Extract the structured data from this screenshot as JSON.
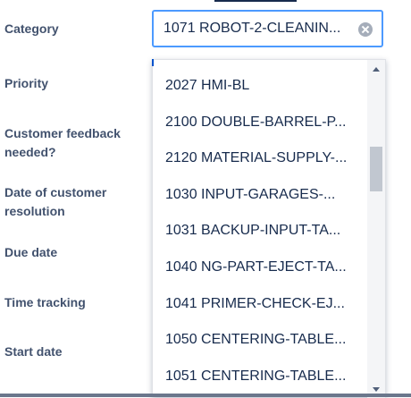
{
  "fields": {
    "category_label": "Category",
    "priority_label": "Priority",
    "customer_feedback_label": "Customer feedback\nneeded?",
    "date_of_customer_resolution_label": "Date of customer\nresolution",
    "due_date_label": "Due date",
    "time_tracking_label": "Time tracking",
    "start_date_label": "Start date"
  },
  "category_select": {
    "value": "1071 ROBOT-2-CLEANIN...",
    "clear_icon": "clear-icon"
  },
  "dropdown": {
    "options": [
      "2027 HMI-BL",
      "2100 DOUBLE-BARREL-P...",
      "2120 MATERIAL-SUPPLY-...",
      "1030 INPUT-GARAGES-...",
      "1031 BACKUP-INPUT-TA...",
      "1040 NG-PART-EJECT-TA...",
      "1041 PRIMER-CHECK-EJ...",
      "1050 CENTERING-TABLE...",
      "1051 CENTERING-TABLE..."
    ],
    "scroll_up_icon": "chevron-up-icon",
    "scroll_down_icon": "chevron-down-icon"
  },
  "colors": {
    "focus_border": "#4c9aff",
    "label_text": "#42526e",
    "option_text": "#172b4d"
  }
}
